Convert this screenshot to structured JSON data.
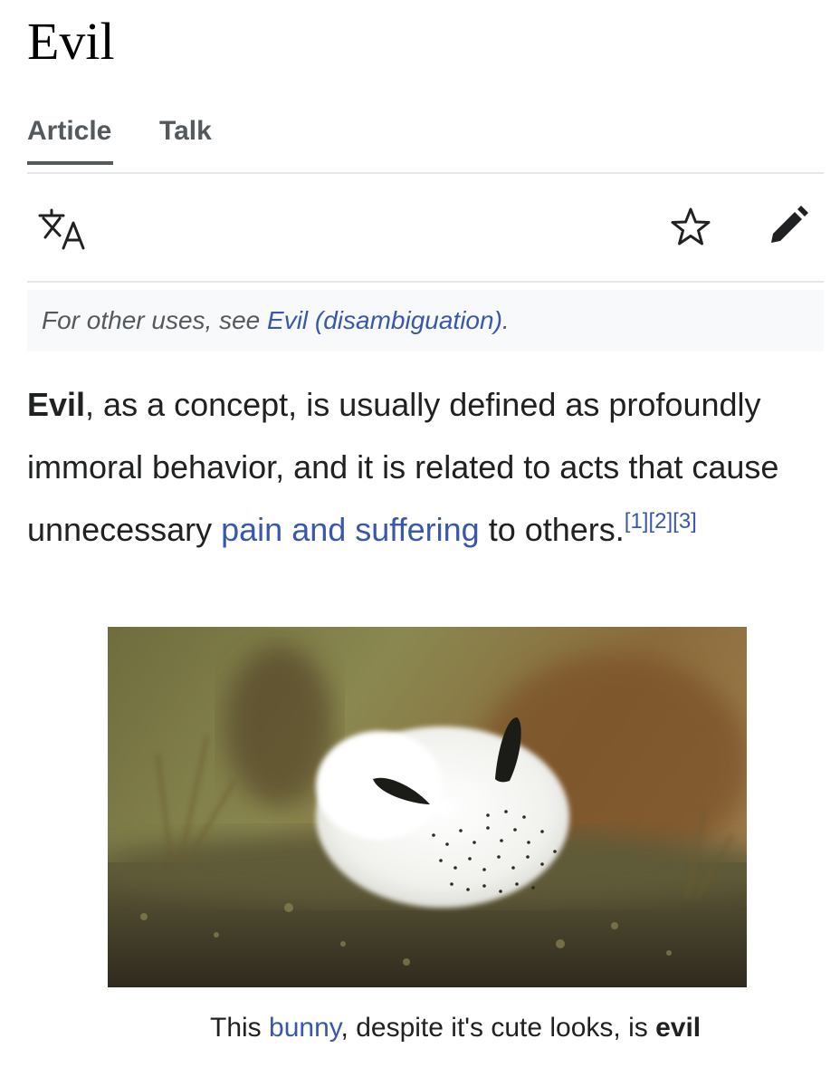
{
  "page": {
    "title": "Evil"
  },
  "tabs": [
    {
      "label": "Article",
      "active": true
    },
    {
      "label": "Talk",
      "active": false
    }
  ],
  "toolbar": {
    "icons": [
      "language-icon",
      "star-icon",
      "pencil-icon"
    ]
  },
  "hatnote": {
    "prefix": "For other uses, see ",
    "link": "Evil (disambiguation)",
    "suffix": "."
  },
  "lead": {
    "bold": "Evil",
    "text1": ", as a concept, is usually defined as profoundly immoral behavior, and it is related to acts that cause unnecessary ",
    "link": "pain and suffering",
    "text2": " to others.",
    "refs": [
      "[1]",
      "[2]",
      "[3]"
    ]
  },
  "figure": {
    "image_subject": "sea-bunny-photo",
    "caption_prefix": "This ",
    "caption_link": "bunny",
    "caption_middle": ", despite it's cute looks, is ",
    "caption_bold": "evil"
  },
  "colors": {
    "link": "#3a58a8",
    "text": "#202122",
    "muted": "#54595d",
    "hatnote_bg": "#f8f9fa",
    "divider": "#e4e5e7"
  }
}
